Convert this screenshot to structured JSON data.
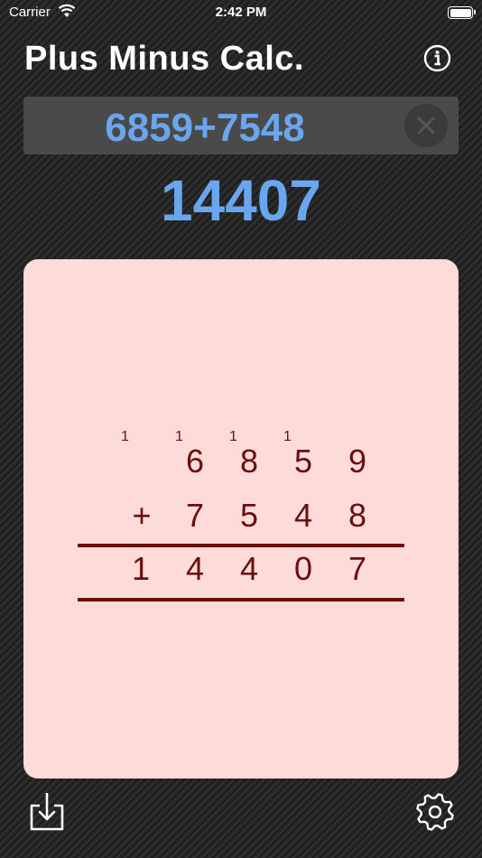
{
  "status_bar": {
    "carrier": "Carrier",
    "time": "2:42 PM"
  },
  "header": {
    "title": "Plus Minus Calc."
  },
  "input": {
    "expression": "6859+7548"
  },
  "result": {
    "value": "14407"
  },
  "worksheet": {
    "carries": [
      "1",
      "1",
      "1",
      "1"
    ],
    "row1": [
      "6",
      "8",
      "5",
      "9"
    ],
    "operator": "+",
    "row2": [
      "7",
      "5",
      "4",
      "8"
    ],
    "answer": [
      "1",
      "4",
      "4",
      "0",
      "7"
    ]
  },
  "colors": {
    "accent": "#6aa6ee",
    "panel": "#fddbd9",
    "ink": "#6b0e0e"
  },
  "icons": {
    "info": "info-icon",
    "clear": "close-icon",
    "export": "export-icon",
    "settings": "gear-icon"
  }
}
